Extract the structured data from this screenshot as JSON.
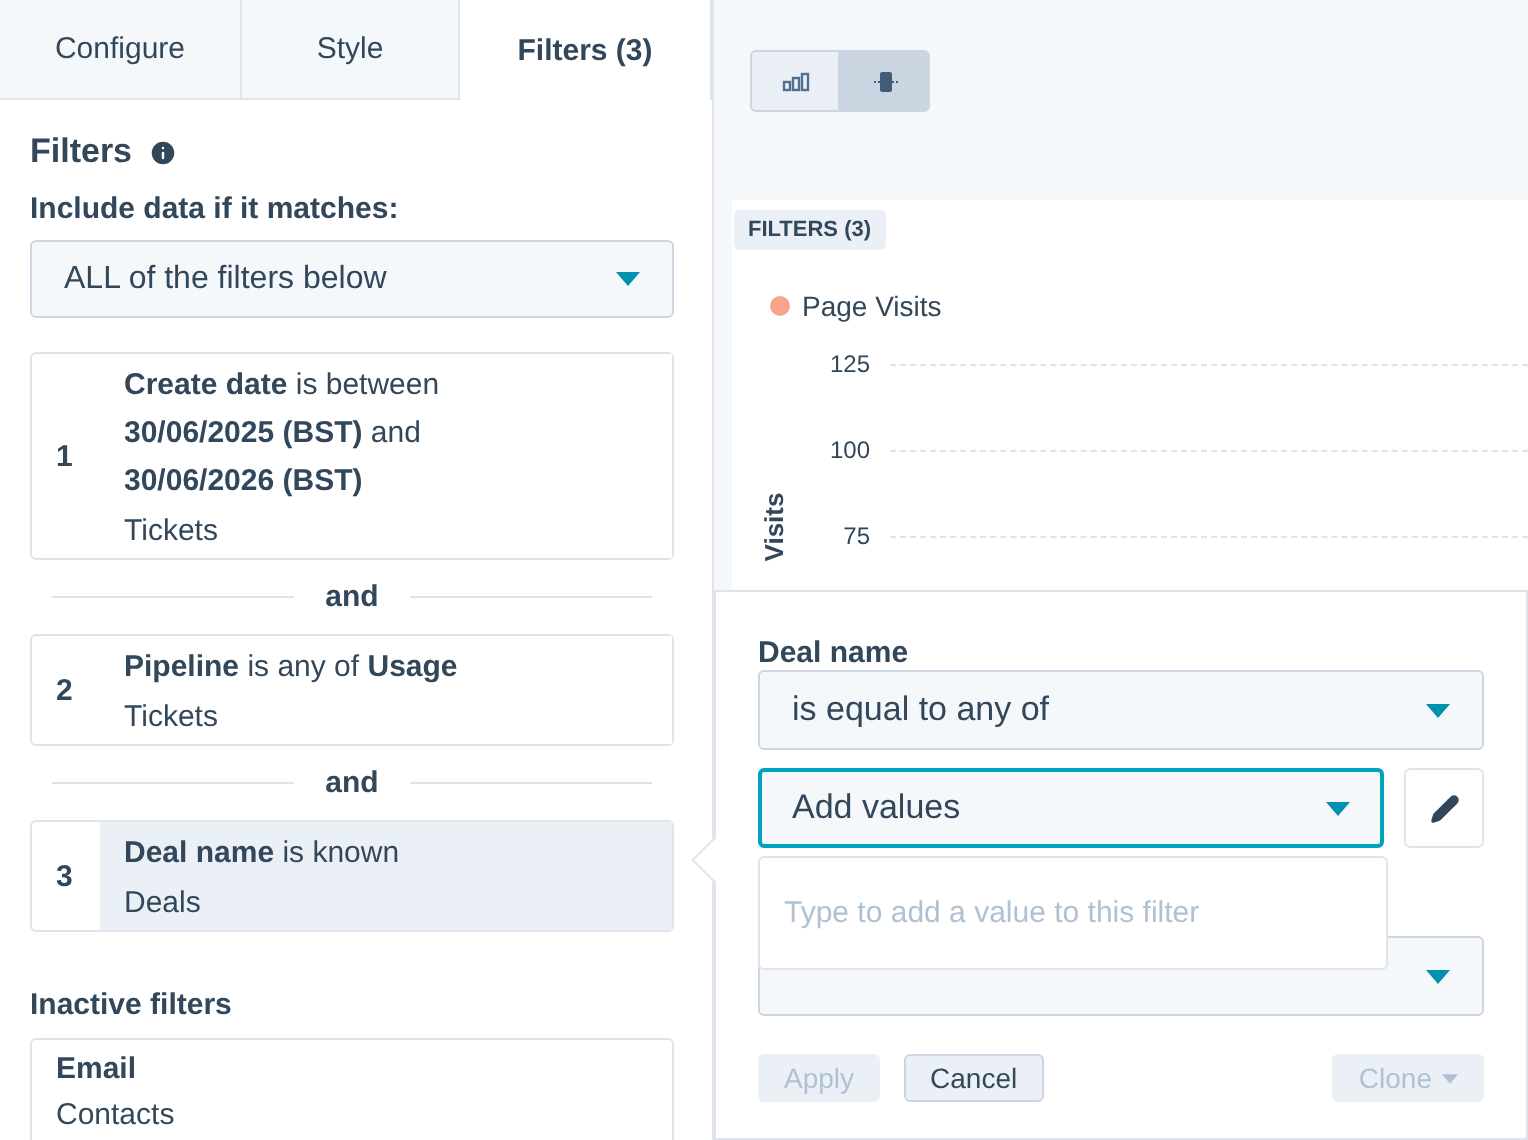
{
  "tabs": [
    {
      "label": "Configure",
      "selected": false
    },
    {
      "label": "Style",
      "selected": false
    },
    {
      "label": "Filters (3)",
      "selected": true
    }
  ],
  "filters": {
    "title": "Filters",
    "match_label": "Include data if it matches:",
    "match_value": "ALL of the filters below",
    "items": [
      {
        "number": "1",
        "text": "**Create date** is between **30/06/2025 (BST)** and **30/06/2026 (BST)**",
        "object": "Tickets",
        "selected": false
      },
      {
        "connector": "and",
        "number": "2",
        "text": "**Pipeline** is any of **Usage**",
        "object": "Tickets",
        "selected": false
      },
      {
        "connector": "and",
        "number": "3",
        "text": "**Deal name** is known",
        "object": "Deals",
        "selected": true
      }
    ],
    "inactive_title": "Inactive filters",
    "inactive": [
      {
        "name": "Email",
        "object": "Contacts"
      }
    ]
  },
  "view_toggle": [
    {
      "kind": "bar",
      "selected": false
    },
    {
      "kind": "table",
      "selected": true
    }
  ],
  "chart": {
    "badge": "FILTERS (3)",
    "legend": [
      {
        "label": "Page Visits",
        "color": "#f8a58c"
      }
    ],
    "y_ticks": [
      "125",
      "100",
      "75"
    ],
    "y_label": "Visits"
  },
  "popover": {
    "field_label": "Deal name",
    "operator": "is equal to any of",
    "value": "Add values",
    "dropdown_placeholder": "Type to add a value to this filter",
    "buttons": [
      {
        "label": "Apply",
        "disabled": true,
        "menu": false
      },
      {
        "label": "Cancel",
        "disabled": false,
        "menu": false
      },
      {
        "label": "Clone",
        "disabled": true,
        "menu": true
      }
    ]
  }
}
